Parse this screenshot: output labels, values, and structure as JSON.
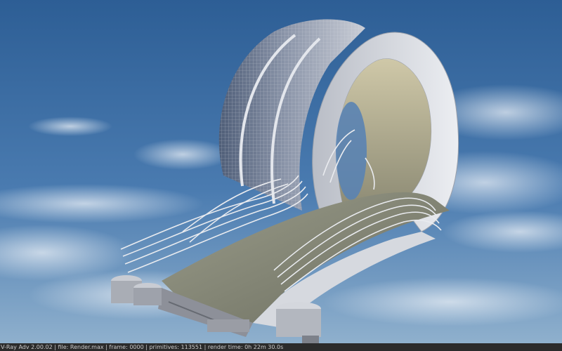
{
  "viewport": {
    "subject": "3D render of a looping bridge structure",
    "sky_colors": {
      "top": "#2d5e95",
      "horizon": "#8fb0cd"
    }
  },
  "status_bar": {
    "text": "V-Ray Adv 2.00.02 | file: Render.max | frame: 0000 | primitives: 113551 | render time: 0h 22m 30.0s"
  }
}
